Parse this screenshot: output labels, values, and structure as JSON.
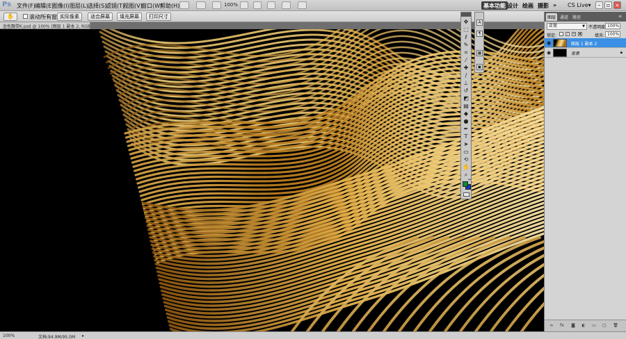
{
  "app": {
    "logo": "Ps"
  },
  "menubar": {
    "items": [
      "文件(F)",
      "编辑(E)",
      "图像(I)",
      "图层(L)",
      "选择(S)",
      "滤镜(T)",
      "视图(V)",
      "窗口(W)",
      "帮助(H)"
    ],
    "zoom": "100%",
    "workspaces": [
      "基本功能",
      "设计",
      "绘画",
      "摄影"
    ],
    "workspace_more": "»",
    "cs_live": "CS Live▾",
    "window_controls": [
      "minimize-icon",
      "restore-icon",
      "close-icon"
    ]
  },
  "options": {
    "tool_icon": "hand-icon",
    "scroll_all_label": "滚动所有窗口",
    "buttons": [
      "实际像素",
      "适合屏幕",
      "填充屏幕",
      "打印尺寸"
    ]
  },
  "document": {
    "tab_label": "金色飘带K.psd @ 100% (图层 1 副本 2, RGB/8) ×",
    "artwork": "golden-ribbon-waves"
  },
  "statusbar": {
    "zoom": "100%",
    "doc_info": "文档:94.9M/95.0M",
    "arrow": "▸"
  },
  "tools": {
    "items": [
      {
        "name": "move-tool-icon",
        "glyph": "✥"
      },
      {
        "name": "marquee-tool-icon",
        "glyph": "⬚"
      },
      {
        "name": "lasso-tool-icon",
        "glyph": "ℓ"
      },
      {
        "name": "quick-select-tool-icon",
        "glyph": "✎"
      },
      {
        "name": "crop-tool-icon",
        "glyph": "⌗"
      },
      {
        "name": "eyedropper-tool-icon",
        "glyph": "⁄"
      },
      {
        "name": "healing-tool-icon",
        "glyph": "✚"
      },
      {
        "name": "brush-tool-icon",
        "glyph": "∕"
      },
      {
        "name": "stamp-tool-icon",
        "glyph": "⊥"
      },
      {
        "name": "history-brush-tool-icon",
        "glyph": "↺"
      },
      {
        "name": "eraser-tool-icon",
        "glyph": "◩"
      },
      {
        "name": "gradient-tool-icon",
        "glyph": "▤"
      },
      {
        "name": "blur-tool-icon",
        "glyph": "◆"
      },
      {
        "name": "dodge-tool-icon",
        "glyph": "●"
      },
      {
        "name": "pen-tool-icon",
        "glyph": "✒"
      },
      {
        "name": "type-tool-icon",
        "glyph": "T"
      },
      {
        "name": "path-select-tool-icon",
        "glyph": "➤"
      },
      {
        "name": "shape-tool-icon",
        "glyph": "▭"
      },
      {
        "name": "3d-rotate-tool-icon",
        "glyph": "⟲"
      },
      {
        "name": "hand-tool-icon",
        "glyph": "✋"
      },
      {
        "name": "zoom-tool-icon",
        "glyph": "⌕"
      }
    ],
    "foreground": "#0a8a2e",
    "background": "#1434c4"
  },
  "minidock": {
    "items": [
      "character-panel-icon",
      "paragraph-panel-icon",
      "history-panel-icon",
      "navigator-panel-icon"
    ],
    "glyphs": [
      "A",
      "¶",
      "▦",
      "▣"
    ]
  },
  "layers_panel": {
    "tabs": [
      "图层",
      "通道",
      "路径"
    ],
    "blend_mode": "正常",
    "opacity_label": "不透明度:",
    "opacity": "100%",
    "lock_label": "锁定:",
    "fill_label": "填充:",
    "fill": "100%",
    "layers": [
      {
        "name": "图层 1 副本 2",
        "selected": true,
        "thumb": "gold"
      },
      {
        "name": "背景",
        "selected": false,
        "thumb": "black",
        "locked": true
      }
    ],
    "footer_icons": [
      "link-layers-icon",
      "fx-icon",
      "mask-icon",
      "adjustment-icon",
      "group-icon",
      "new-layer-icon",
      "trash-icon"
    ],
    "footer_glyphs": [
      "∞",
      "fx",
      "◙",
      "◐",
      "▭",
      "▢",
      "🗑"
    ]
  }
}
